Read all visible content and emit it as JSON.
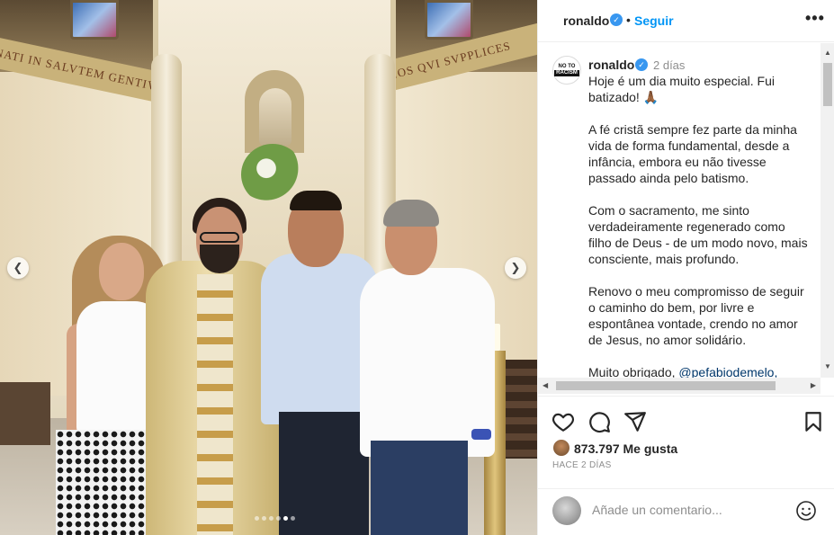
{
  "post": {
    "username": "ronaldo",
    "separator": "•",
    "follow_label": "Seguir",
    "more_label": "•••",
    "time_ago": "2 días",
    "caption": [
      "Hoje é um dia muito especial. Fui batizado! 🙏🏾",
      "A fé cristã sempre fez parte da minha vida de forma fundamental, desde a infância, embora eu não tivesse passado ainda pelo batismo.",
      "Com o sacramento, me sinto verdadeiramente regenerado como filho de Deus - de um modo novo, mais consciente, mais profundo.",
      "Renovo o meu compromisso de seguir o caminho do bem, por livre e espontânea vontade, crendo no amor de Jesus, no amor solidário."
    ],
    "caption_last_prefix": "Muito obrigado, ",
    "caption_mention": "@pefabiodemelo,",
    "avatar_logo": {
      "line1": "NO TO",
      "line2": "RACISM"
    },
    "likes": "873.797 Me gusta",
    "date_label": "HACE 2 DÍAS",
    "comment_placeholder": "Añade un comentario...",
    "frieze_left": "NATI IN SALVTEM GENTIVM",
    "frieze_right": "NOS QVI SVPPLICES"
  },
  "carousel": {
    "slide_count": 6,
    "active_index": 4
  },
  "icons": {
    "verified": "verified-badge-icon",
    "like": "heart-icon",
    "comment": "speech-bubble-icon",
    "share": "paper-plane-icon",
    "save": "bookmark-icon",
    "emoji": "smiley-icon",
    "prev": "chevron-left-icon",
    "next": "chevron-right-icon"
  },
  "colors": {
    "accent": "#0095f6",
    "verified": "#3897f0",
    "mention": "#00376b",
    "muted": "#8e8e8e"
  }
}
